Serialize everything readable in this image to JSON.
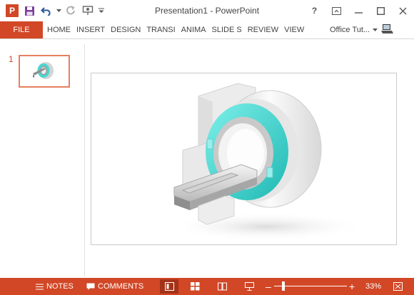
{
  "app": {
    "title": "Presentation1 - PowerPoint",
    "logo_letter": "P",
    "accent_color": "#d24726"
  },
  "qat": {
    "icons": [
      "powerpoint-logo",
      "save-icon",
      "undo-icon",
      "redo-icon",
      "start-from-beginning-icon",
      "customize-qat-icon"
    ]
  },
  "window": {
    "help_label": "?",
    "controls": [
      "ribbon-display-options-icon",
      "minimize-icon",
      "maximize-icon",
      "close-icon"
    ]
  },
  "ribbon": {
    "file_label": "FILE",
    "tabs": [
      "HOME",
      "INSERT",
      "DESIGN",
      "TRANSI",
      "ANIMA",
      "SLIDE S",
      "REVIEW",
      "VIEW"
    ],
    "account_label": "Office Tut..."
  },
  "thumbnails": [
    {
      "number": "1",
      "selected": true
    }
  ],
  "statusbar": {
    "notes_label": "NOTES",
    "comments_label": "COMMENTS",
    "zoom_level": "33%",
    "zoom_fraction": 0.33,
    "views": [
      "normal-view-icon",
      "slide-sorter-icon",
      "reading-view-icon",
      "slide-show-icon"
    ],
    "active_view": "normal-view-icon"
  }
}
